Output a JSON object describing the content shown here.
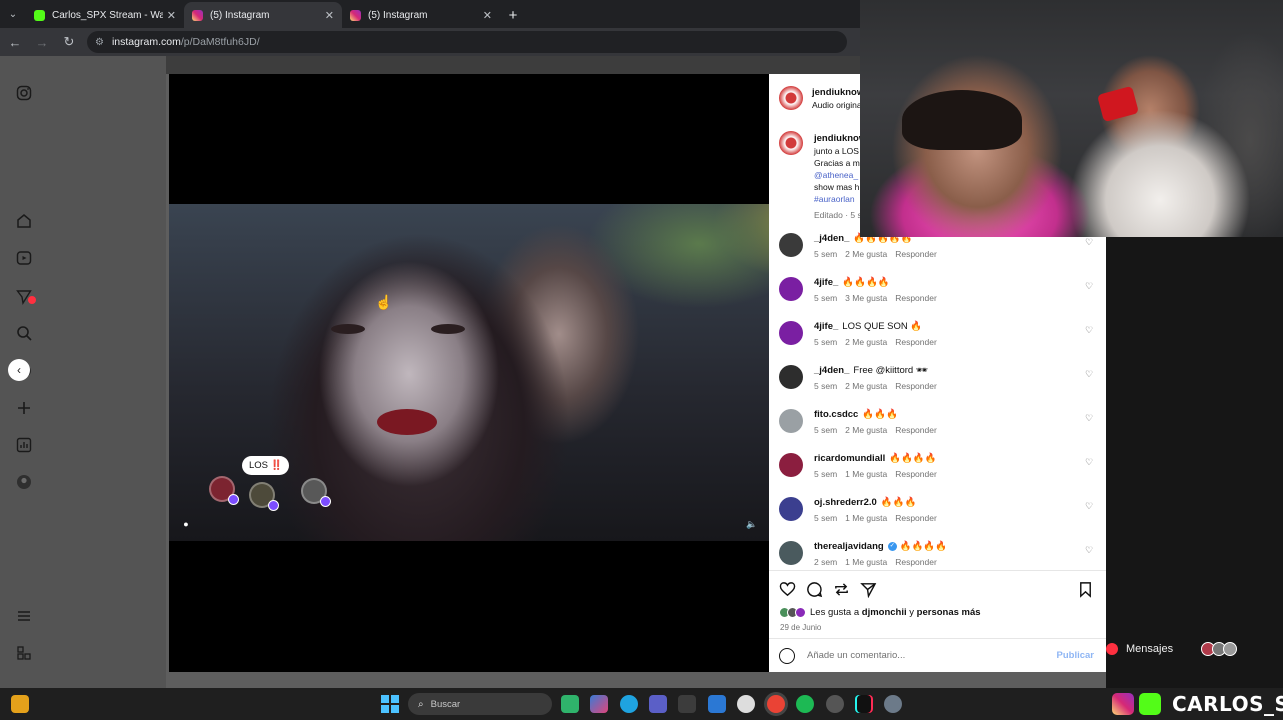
{
  "browser": {
    "tabs": [
      {
        "title": "Carlos_SPX Stream - Watch Live",
        "favicon": "kick-icon"
      },
      {
        "title": "(5) Instagram",
        "favicon": "instagram-icon"
      },
      {
        "title": "(5) Instagram",
        "favicon": "instagram-icon"
      }
    ],
    "active_tab": 1,
    "url_host": "instagram.com",
    "url_path": "/p/DaM8tfuh6JD/"
  },
  "post": {
    "bubble_text": "LOS ‼️",
    "author": "jendiuknow",
    "audio": "Audio original",
    "caption_lines": [
      "junto a LOS",
      "Gracias a m",
      "@athenea_",
      "show mas h",
      "#auraorlan"
    ],
    "edited": "Editado · 5 s"
  },
  "comments": [
    {
      "user": "_j4den_",
      "text": "🔥🔥🔥🔥🔥",
      "time": "5 sem",
      "likes": "2 Me gusta",
      "reply": "Responder",
      "avatar": "#3a3a3a"
    },
    {
      "user": "4jife_",
      "text": "🔥🔥🔥🔥",
      "time": "5 sem",
      "likes": "3 Me gusta",
      "reply": "Responder",
      "avatar": "#7a1fa2"
    },
    {
      "user": "4jife_",
      "text": "LOS QUE SON 🔥",
      "time": "5 sem",
      "likes": "2 Me gusta",
      "reply": "Responder",
      "avatar": "#7a1fa2"
    },
    {
      "user": "_j4den_",
      "text": "Free @kiittord 🕶",
      "time": "5 sem",
      "likes": "2 Me gusta",
      "reply": "Responder",
      "avatar": "#2d2d2d"
    },
    {
      "user": "fito.csdcc",
      "text": "🔥🔥🔥",
      "time": "5 sem",
      "likes": "2 Me gusta",
      "reply": "Responder",
      "avatar": "#9aa0a4"
    },
    {
      "user": "ricardomundiall",
      "text": "🔥🔥🔥🔥",
      "time": "5 sem",
      "likes": "1 Me gusta",
      "reply": "Responder",
      "avatar": "#8b1e3f"
    },
    {
      "user": "oj.shrederr2.0",
      "text": "🔥🔥🔥",
      "time": "5 sem",
      "likes": "1 Me gusta",
      "reply": "Responder",
      "avatar": "#3b3f8f"
    },
    {
      "user": "therealjavidang",
      "text": "🔥🔥🔥🔥",
      "time": "2 sem",
      "likes": "1 Me gusta",
      "reply": "Responder",
      "avatar": "#4a5a5e",
      "verified": true
    }
  ],
  "likes_line": {
    "prefix": "Les gusta a",
    "user": "djmonchii",
    "joiner": "y",
    "suffix": "personas más"
  },
  "post_date": "29 de Junio",
  "comment_placeholder": "Añade un comentario...",
  "publish": "Publicar",
  "messages_label": "Mensajes",
  "taskbar": {
    "search_placeholder": "Buscar"
  },
  "streamer": "CARLOS_SPX",
  "colors": {
    "accent_kick": "#53fc18",
    "ig_blue": "#4a63c8",
    "notify_red": "#ff3040"
  }
}
